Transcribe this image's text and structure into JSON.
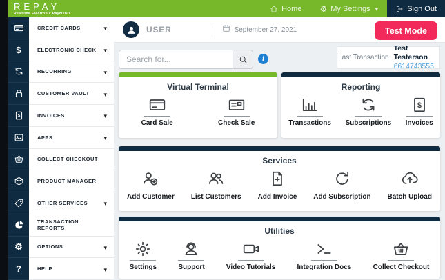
{
  "brand": {
    "name": "REPAY",
    "tagline": "Realtime Electronic Payments"
  },
  "topnav": {
    "items": [
      {
        "label": "Home",
        "icon": "home"
      },
      {
        "label": "My Settings",
        "icon": "gear-glyph",
        "caret": true
      },
      {
        "label": "Sign Out",
        "icon": "sign-out"
      }
    ]
  },
  "header": {
    "user_label": "USER",
    "date": "September 27, 2021",
    "test_mode_label": "Test Mode"
  },
  "search": {
    "placeholder": "Search for..."
  },
  "last_transaction": {
    "label": "Last Transaction",
    "name": "Test Testerson",
    "phone": "6614743555"
  },
  "sidebar": {
    "items": [
      {
        "label": "CREDIT CARDS",
        "icon": "credit-card",
        "caret": true
      },
      {
        "label": "ELECTRONIC CHECK",
        "icon": "dollar",
        "caret": true
      },
      {
        "label": "RECURRING",
        "icon": "refresh",
        "caret": true
      },
      {
        "label": "CUSTOMER VAULT",
        "icon": "lock",
        "caret": true
      },
      {
        "label": "INVOICES",
        "icon": "invoice",
        "caret": true
      },
      {
        "label": "APPS",
        "icon": "apps",
        "caret": true
      },
      {
        "label": "COLLECT CHECKOUT",
        "icon": "basket",
        "caret": false
      },
      {
        "label": "PRODUCT MANAGER",
        "icon": "box",
        "caret": false
      },
      {
        "label": "OTHER SERVICES",
        "icon": "tag",
        "caret": true
      },
      {
        "label": "TRANSACTION REPORTS",
        "icon": "pie-chart",
        "caret": false
      },
      {
        "label": "OPTIONS",
        "icon": "gears-glyph",
        "caret": true
      },
      {
        "label": "HELP",
        "icon": "question",
        "caret": true
      }
    ]
  },
  "panels": [
    {
      "title": "Virtual Terminal",
      "accent": "green",
      "items": [
        {
          "label": "Card Sale",
          "icon": "credit-card"
        },
        {
          "label": "Check Sale",
          "icon": "check-doc"
        }
      ]
    },
    {
      "title": "Reporting",
      "accent": "navy",
      "items": [
        {
          "label": "Transactions",
          "icon": "bar-chart"
        },
        {
          "label": "Subscriptions",
          "icon": "refresh"
        },
        {
          "label": "Invoices",
          "icon": "invoice"
        }
      ]
    },
    {
      "title": "Services",
      "accent": "navy",
      "items": [
        {
          "label": "Add Customer",
          "icon": "person-add"
        },
        {
          "label": "List Customers",
          "icon": "people"
        },
        {
          "label": "Add Invoice",
          "icon": "doc-plus"
        },
        {
          "label": "Add Subscription",
          "icon": "redo"
        },
        {
          "label": "Batch Upload",
          "icon": "cloud-upload"
        }
      ]
    },
    {
      "title": "Utilities",
      "accent": "navy",
      "items": [
        {
          "label": "Settings",
          "icon": "gear"
        },
        {
          "label": "Support",
          "icon": "support"
        },
        {
          "label": "Video Tutorials",
          "icon": "video-camera"
        },
        {
          "label": "Integration Docs",
          "icon": "terminal"
        },
        {
          "label": "Collect Checkout",
          "icon": "basket"
        }
      ]
    }
  ],
  "icons": {
    "search": "search",
    "info": "info-i",
    "calendar": "calendar",
    "avatar": "person-filled"
  },
  "colors": {
    "brand_green": "#76b82a",
    "navy": "#0e2b41",
    "test_mode_pink": "#f2295b",
    "link_blue": "#4a9edb",
    "info_blue": "#1d7fd1",
    "background": "#edf0f2"
  }
}
